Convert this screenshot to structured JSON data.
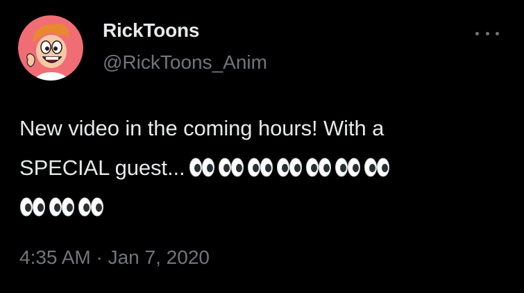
{
  "tweet": {
    "display_name": "RickToons",
    "handle": "@RickToons_Anim",
    "text_line1": "New video in the coming hours! With a",
    "text_line2": "SPECIAL guest...",
    "emoji": "👀",
    "emoji_line2_count": 7,
    "emoji_line3_count": 3,
    "timestamp": "4:35 AM · Jan 7, 2020"
  },
  "colors": {
    "background": "#000000",
    "primary_text": "#e7e9ea",
    "secondary_text": "#71767b",
    "avatar_bg": "#f06d75"
  },
  "icons": {
    "more": "more-horizontal-icon",
    "avatar": "cartoon-avatar",
    "emoji": "eyes-emoji"
  }
}
